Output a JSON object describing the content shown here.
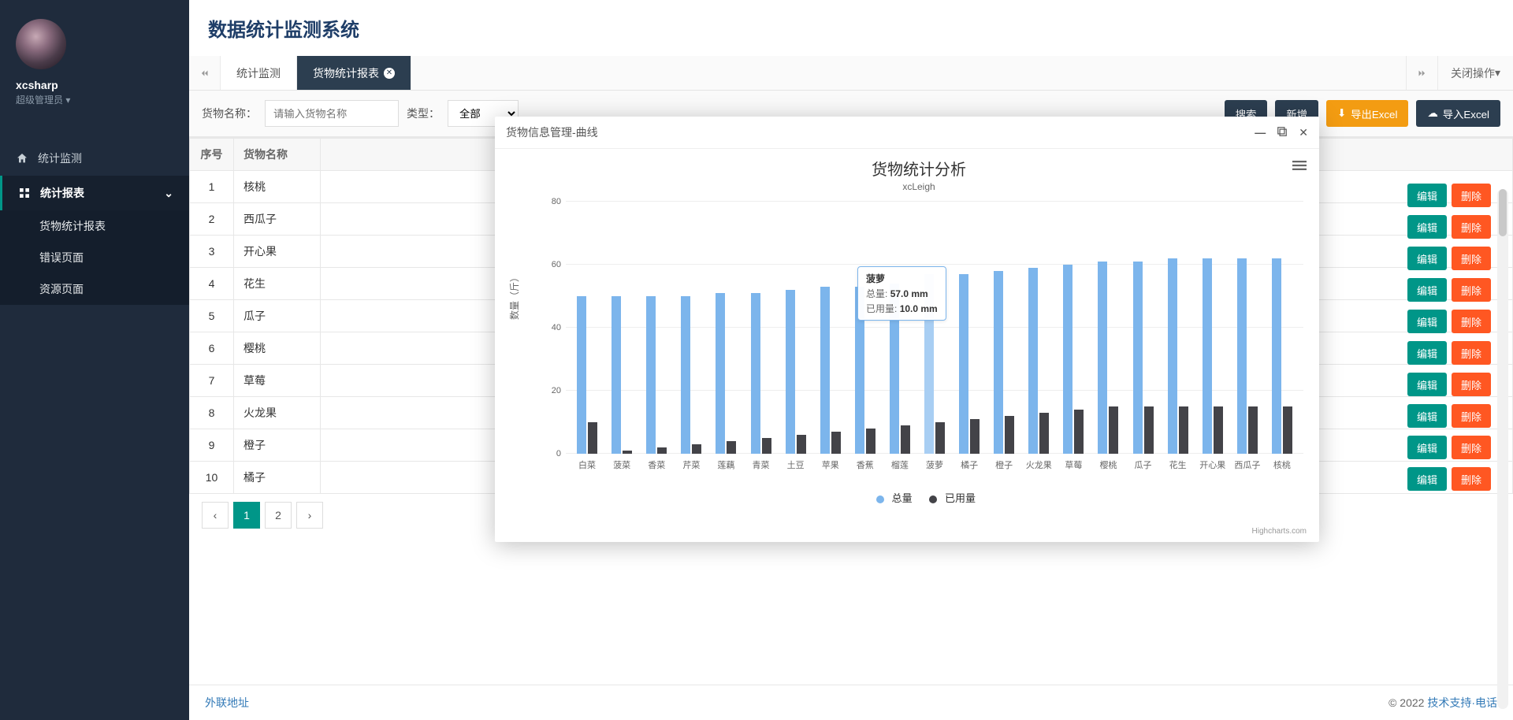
{
  "sidebar": {
    "username": "xcsharp",
    "role_label": "超级管理员",
    "nav": [
      {
        "icon": "home",
        "label": "统计监测"
      }
    ],
    "nav_active": {
      "icon": "grid",
      "label": "统计报表"
    },
    "sub": [
      {
        "label": "货物统计报表"
      },
      {
        "label": "错误页面"
      },
      {
        "label": "资源页面"
      }
    ]
  },
  "header": {
    "title": "数据统计监测系统"
  },
  "tabs": {
    "items": [
      {
        "label": "统计监测",
        "closable": false,
        "active": false
      },
      {
        "label": "货物统计报表",
        "closable": true,
        "active": true
      }
    ],
    "close_ops": "关闭操作"
  },
  "toolbar": {
    "name_label": "货物名称：",
    "name_placeholder": "请输入货物名称",
    "type_label": "类型：",
    "type_value": "全部",
    "buttons": {
      "search": "搜索",
      "add": "新增",
      "export": "导出Excel",
      "import": "导入Excel"
    }
  },
  "table": {
    "headers": {
      "idx": "序号",
      "name": "货物名称"
    },
    "rows": [
      {
        "idx": 1,
        "name": "核桃"
      },
      {
        "idx": 2,
        "name": "西瓜子"
      },
      {
        "idx": 3,
        "name": "开心果"
      },
      {
        "idx": 4,
        "name": "花生"
      },
      {
        "idx": 5,
        "name": "瓜子"
      },
      {
        "idx": 6,
        "name": "樱桃"
      },
      {
        "idx": 7,
        "name": "草莓"
      },
      {
        "idx": 8,
        "name": "火龙果"
      },
      {
        "idx": 9,
        "name": "橙子"
      },
      {
        "idx": 10,
        "name": "橘子"
      }
    ],
    "actions": {
      "edit": "编辑",
      "delete": "删除"
    },
    "pager": {
      "pages": [
        "1",
        "2"
      ],
      "current": "1"
    }
  },
  "footer": {
    "left": "外联地址",
    "right_prefix": "© 2022 ",
    "right_link": "技术支持·电话"
  },
  "modal": {
    "title": "货物信息管理-曲线",
    "chart_title": "货物统计分析",
    "chart_subtitle": "xcLeigh",
    "credit": "Highcharts.com",
    "tooltip": {
      "cat": "菠萝",
      "k1": "总量:",
      "v1": "57.0 mm",
      "k2": "已用量:",
      "v2": "10.0 mm"
    },
    "watermark": ""
  },
  "chart_data": {
    "type": "bar",
    "title": "货物统计分析",
    "subtitle": "xcLeigh",
    "ylabel": "数量（斤）",
    "xlabel": "",
    "ylim": [
      0,
      80
    ],
    "yticks": [
      0,
      20,
      40,
      60,
      80
    ],
    "categories": [
      "白菜",
      "菠菜",
      "香菜",
      "芹菜",
      "莲藕",
      "青菜",
      "土豆",
      "苹果",
      "香蕉",
      "榴莲",
      "菠萝",
      "橘子",
      "橙子",
      "火龙果",
      "草莓",
      "樱桃",
      "瓜子",
      "花生",
      "开心果",
      "西瓜子",
      "核桃"
    ],
    "series": [
      {
        "name": "总量",
        "color": "#7cb5ec",
        "values": [
          50,
          50,
          50,
          50,
          51,
          51,
          52,
          53,
          53,
          54,
          57,
          57,
          58,
          59,
          60,
          61,
          61,
          62,
          62,
          62,
          62
        ]
      },
      {
        "name": "已用量",
        "color": "#434348",
        "values": [
          10,
          1,
          2,
          3,
          4,
          5,
          6,
          7,
          8,
          9,
          10,
          11,
          12,
          13,
          14,
          15,
          15,
          15,
          15,
          15,
          15
        ]
      }
    ],
    "highlight_index": 10
  }
}
